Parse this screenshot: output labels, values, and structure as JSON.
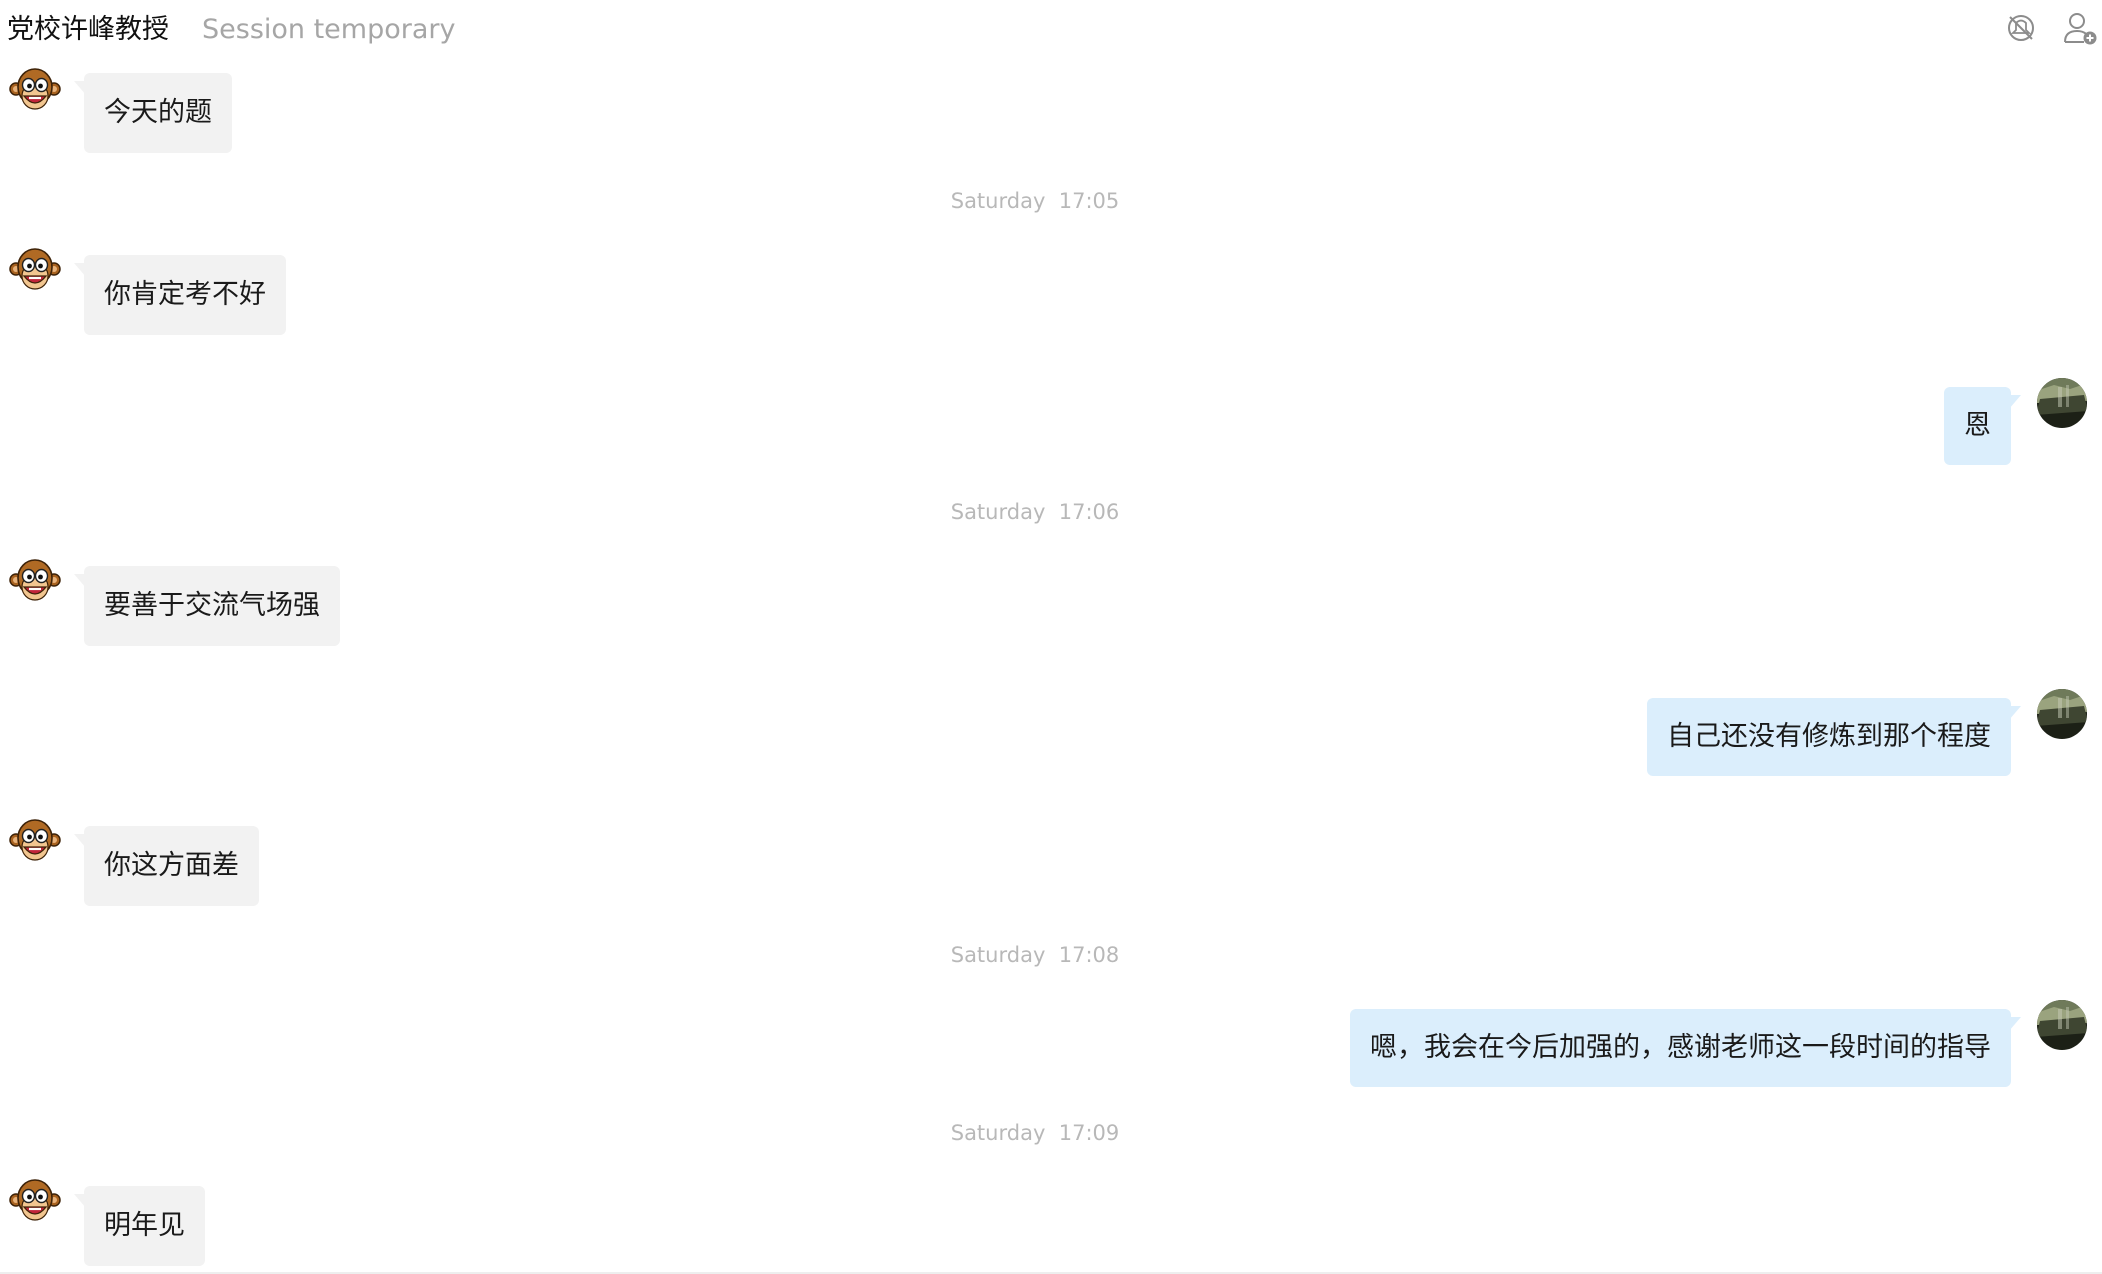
{
  "header": {
    "title": "党校许峰教授",
    "subtitle": "Session temporary",
    "icons": [
      "mute-icon",
      "add-contact-icon"
    ]
  },
  "messages": [
    {
      "side": "incoming",
      "text": "今天的题"
    },
    {
      "type": "timestamp",
      "text": "Saturday  17:05"
    },
    {
      "side": "incoming",
      "text": "你肯定考不好"
    },
    {
      "side": "outgoing",
      "text": "恩"
    },
    {
      "type": "timestamp",
      "text": "Saturday  17:06"
    },
    {
      "side": "incoming",
      "text": "要善于交流气场强"
    },
    {
      "side": "outgoing",
      "text": "自己还没有修炼到那个程度"
    },
    {
      "side": "incoming",
      "text": "你这方面差"
    },
    {
      "type": "timestamp",
      "text": "Saturday  17:08"
    },
    {
      "side": "outgoing",
      "text": "嗯，我会在今后加强的，感谢老师这一段时间的指导"
    },
    {
      "type": "timestamp",
      "text": "Saturday  17:09"
    },
    {
      "side": "incoming",
      "text": "明年见"
    }
  ],
  "colors": {
    "incoming_bubble": "#f2f2f2",
    "outgoing_bubble": "#dbeefc",
    "timestamp_text": "#b8b8b8",
    "subtitle_text": "#a6a6a6"
  }
}
